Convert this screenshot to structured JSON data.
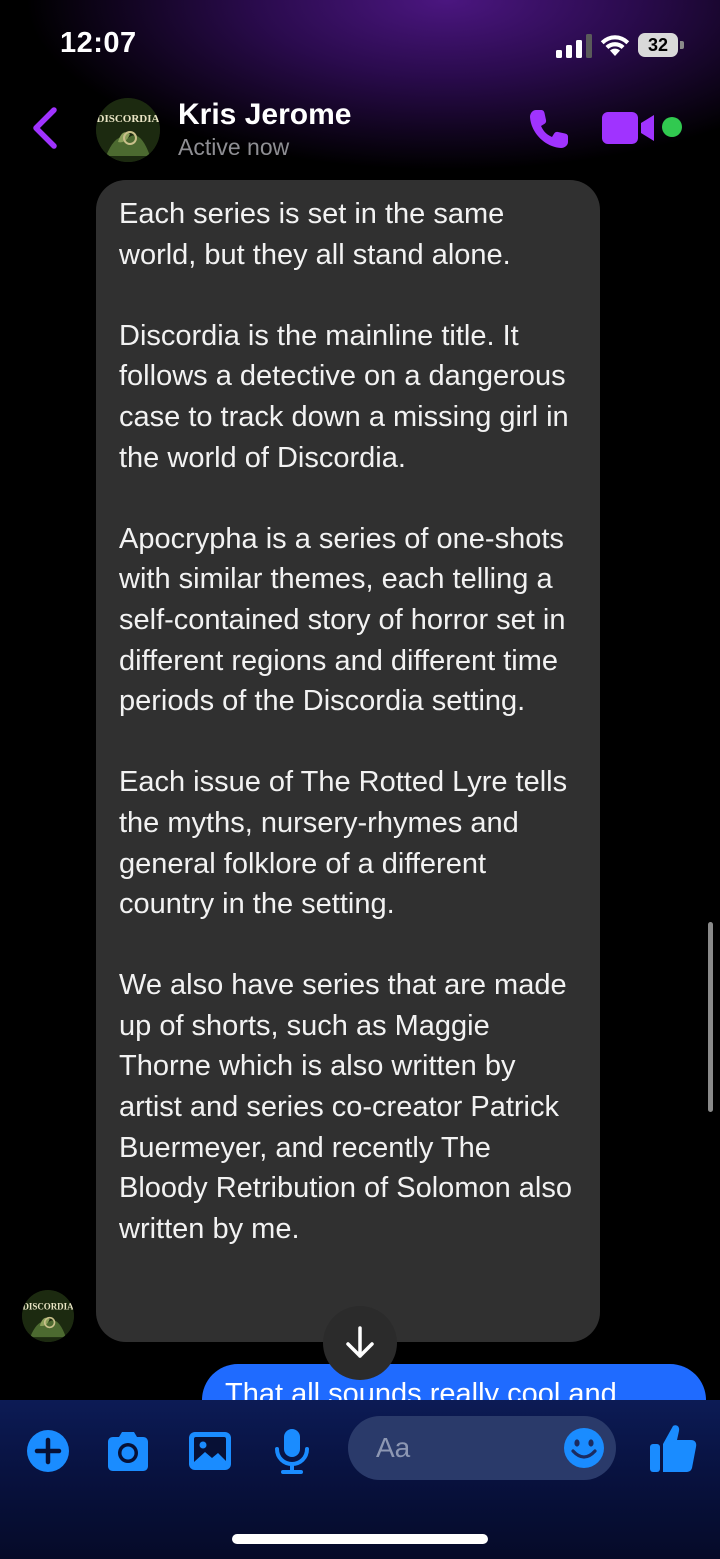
{
  "status_bar": {
    "time": "12:07",
    "battery": "32"
  },
  "header": {
    "contact_name": "Kris Jerome",
    "contact_status": "Active now",
    "avatar_logo_text": "DISCORDIA"
  },
  "messages": {
    "incoming": {
      "paragraphs": [
        "Each series is set in the same world, but they all stand alone.",
        "Discordia is the mainline title. It follows a detective on a dangerous case to track down a missing girl in the world of Discordia.",
        "Apocrypha is a series of one-shots with similar themes, each telling a self-contained story of horror set in different regions and different time periods of the Discordia setting.",
        "Each issue of The Rotted Lyre tells the myths, nursery-rhymes and general folklore of a different country in the setting.",
        "We also have series that are made up of shorts, such as Maggie Thorne which is also written by artist and series co-creator Patrick Buermeyer, and recently The Bloody Retribution of Solomon also written by me."
      ]
    },
    "outgoing": {
      "text": "That all sounds really cool and"
    }
  },
  "composer": {
    "placeholder": "Aa"
  },
  "colors": {
    "accent_purple": "#a033ff",
    "bubble_incoming": "#303030",
    "bubble_outgoing": "#1f6bff",
    "composer_icon_blue": "#1a8cff",
    "online_green": "#31c950"
  },
  "icons": {
    "back": "chevron-left-icon",
    "call": "phone-icon",
    "video": "video-camera-icon",
    "scroll": "arrow-down-icon",
    "add": "plus-circle-icon",
    "camera": "camera-icon",
    "gallery": "image-icon",
    "mic": "microphone-icon",
    "emoji": "smiley-icon",
    "like": "thumbs-up-icon"
  }
}
